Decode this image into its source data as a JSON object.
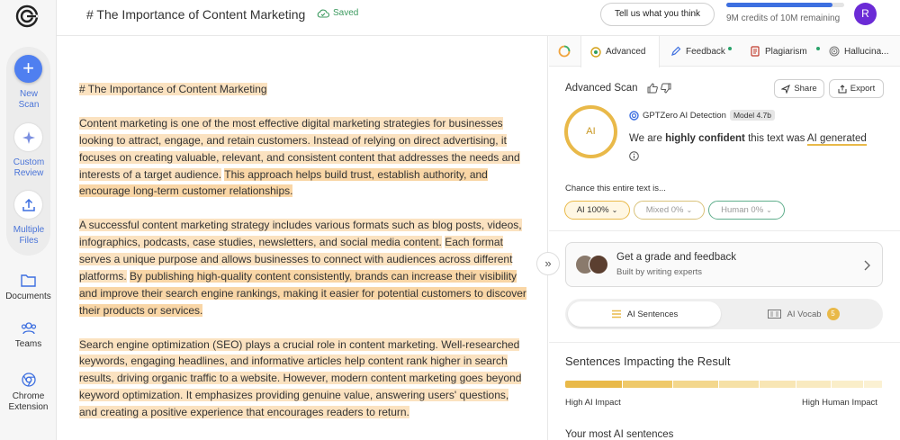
{
  "app": {
    "doc_title": "# The Importance of Content Marketing",
    "saved_label": "Saved",
    "feedback_button": "Tell us what you think",
    "credits_text": "9M credits of 10M remaining",
    "credits_fraction": 0.9,
    "avatar_initial": "R"
  },
  "sidebar": {
    "tools": [
      {
        "label_1": "New",
        "label_2": "Scan",
        "icon": "plus-icon"
      },
      {
        "label_1": "Custom",
        "label_2": "Review",
        "icon": "sparkle-icon"
      },
      {
        "label_1": "Multiple",
        "label_2": "Files",
        "icon": "upload-icon"
      }
    ],
    "nav": [
      {
        "label_1": "Documents",
        "label_2": "",
        "icon": "folder-icon"
      },
      {
        "label_1": "Teams",
        "label_2": "",
        "icon": "team-icon"
      },
      {
        "label_1": "Chrome",
        "label_2": "Extension",
        "icon": "chrome-icon"
      }
    ]
  },
  "editor": {
    "heading": "# The Importance of Content Marketing",
    "p1_a": "Content marketing is one of the most effective digital marketing strategies for businesses looking to attract, engage, and retain customers. Instead of relying on direct advertising, it focuses on creating valuable, relevant, and consistent content that addresses the needs and interests of a target audience.",
    "p1_b": "This approach helps build trust, establish authority, and encourage long-term customer relationships.",
    "p2_a": "A successful content marketing strategy includes various formats such as blog posts, videos, infographics, podcasts, case studies, newsletters, and social media content.",
    "p2_b": "Each format serves a unique purpose and allows businesses to connect with audiences across different platforms.",
    "p2_c": "By publishing high-quality content consistently, brands can increase their visibility and improve their search engine rankings, making it easier for potential customers to discover their products or services.",
    "p3_a": "Search engine optimization (SEO) plays a crucial role in content marketing. Well-researched keywords, engaging headlines, and informative articles help content rank higher in search results, driving organic traffic to a website. However, modern content marketing goes beyond keyword optimization. It emphasizes providing genuine value, answering users' questions, and creating a positive experience that encourages readers to return."
  },
  "panel": {
    "tabs": [
      {
        "label": "Advanced",
        "icon": "advanced-icon"
      },
      {
        "label": "Feedback",
        "icon": "feedback-icon"
      },
      {
        "label": "Plagiarism",
        "icon": "plagiarism-icon"
      },
      {
        "label": "Hallucina...",
        "icon": "hallucination-icon"
      }
    ],
    "scan_title": "Advanced Scan",
    "share_label": "Share",
    "export_label": "Export",
    "ring_label": "AI",
    "detector_name": "GPTZero AI Detection",
    "model_badge": "Model 4.7b",
    "confidence_pre": "We are ",
    "confidence_bold": "highly confident",
    "confidence_mid": " this text was ",
    "confidence_result": "AI generated",
    "chance_label": "Chance this entire text is...",
    "pct_ai": "AI 100%",
    "pct_mixed": "Mixed 0%",
    "pct_human": "Human 0%",
    "grade_title": "Get a grade and feedback",
    "grade_sub": "Built by writing experts",
    "seg_sentences": "AI Sentences",
    "seg_vocab": "AI Vocab",
    "vocab_count": "5",
    "impact_title": "Sentences Impacting the Result",
    "impact_left": "High AI Impact",
    "impact_right": "High Human Impact",
    "most_title": "Your most AI sentences",
    "colors": {
      "accent_blue": "#3d6fe0",
      "ai_gold": "#e9b949",
      "mixed_gold": "#d9c27a",
      "human_green": "#5fae8c"
    }
  }
}
